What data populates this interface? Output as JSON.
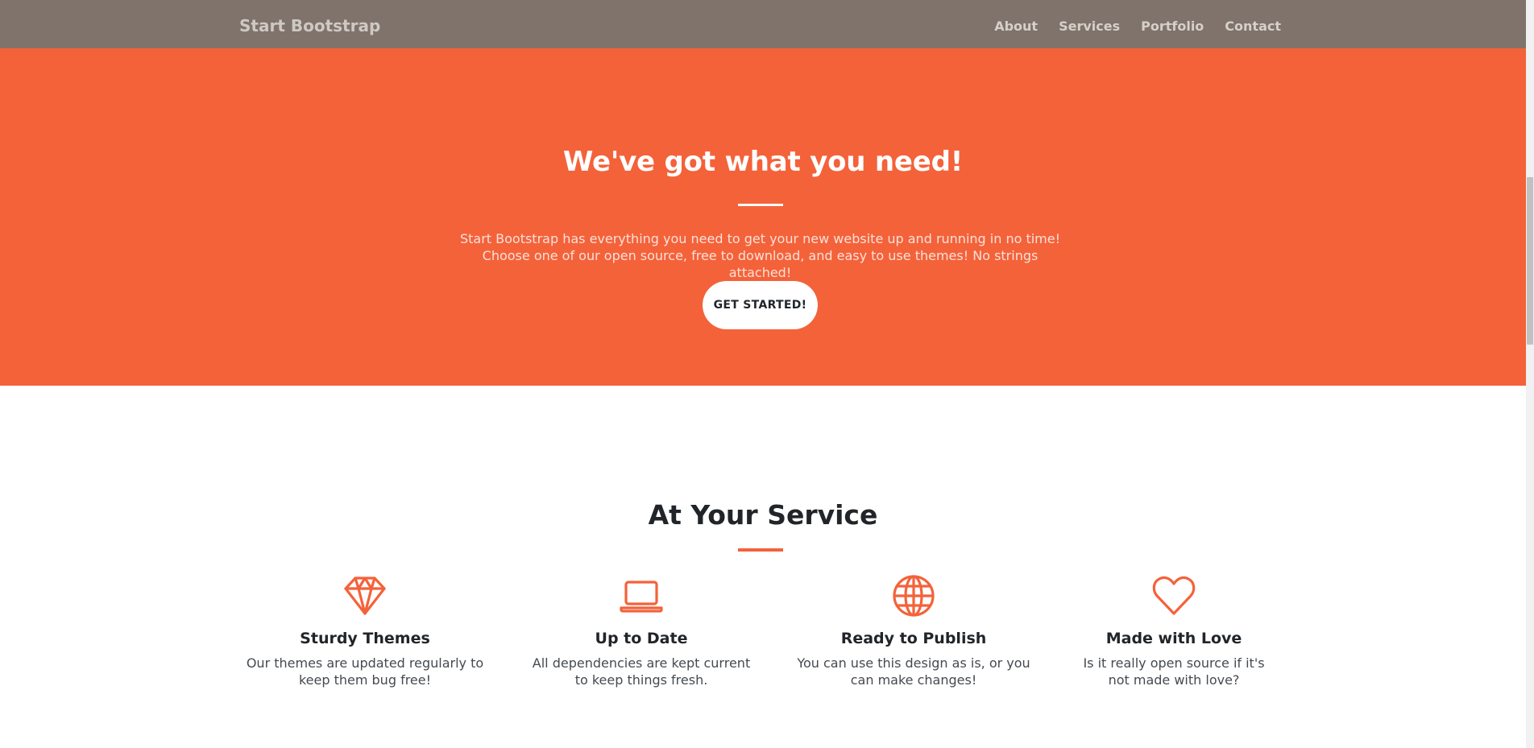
{
  "navbar": {
    "brand": "Start Bootstrap",
    "links": [
      "About",
      "Services",
      "Portfolio",
      "Contact"
    ]
  },
  "hero": {
    "title": "We've got what you need!",
    "lead": "Start Bootstrap has everything you need to get your new website up and running in no time! Choose one of our open source, free to download, and easy to use themes! No strings attached!",
    "button": "GET STARTED!"
  },
  "services": {
    "title": "At Your Service",
    "items": [
      {
        "icon": "gem-icon",
        "title": "Sturdy Themes",
        "text": "Our themes are updated regularly to keep them bug free!"
      },
      {
        "icon": "laptop-icon",
        "title": "Up to Date",
        "text": "All dependencies are kept current to keep things fresh."
      },
      {
        "icon": "globe-icon",
        "title": "Ready to Publish",
        "text": "You can use this design as is, or you can make changes!"
      },
      {
        "icon": "heart-icon",
        "title": "Made with Love",
        "text": "Is it really open source if it's not made with love?"
      }
    ]
  },
  "colors": {
    "primary": "#f4623a",
    "navbar": "#7f736b",
    "text_dark": "#212529"
  }
}
